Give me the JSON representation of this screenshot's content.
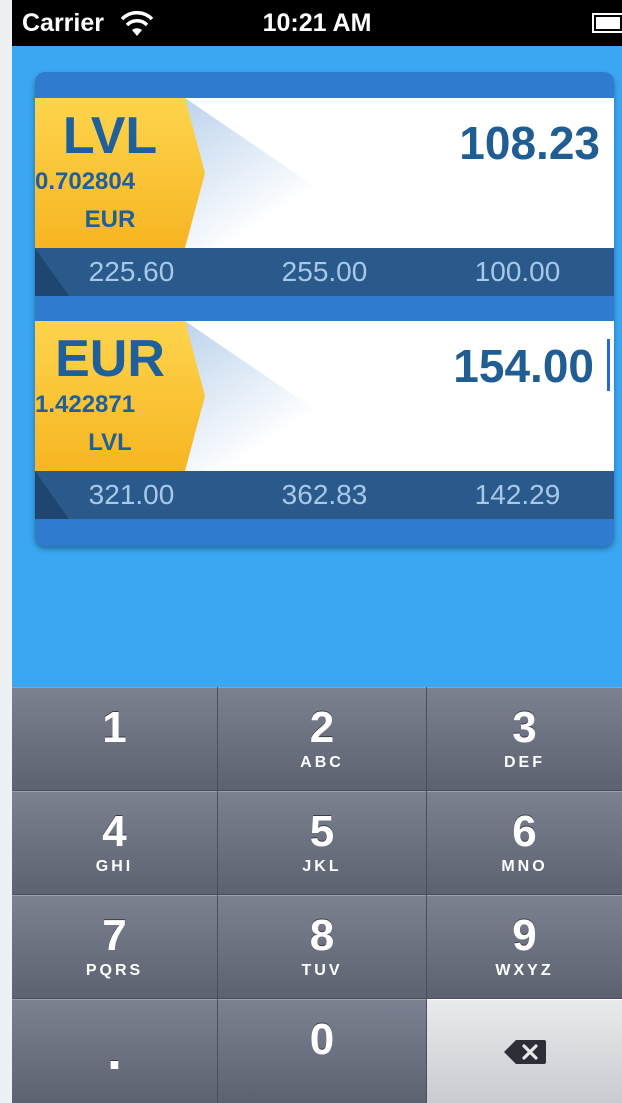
{
  "status_bar": {
    "carrier": "Carrier",
    "time": "10:21 AM",
    "wifi_icon": "wifi-icon",
    "battery_icon": "battery-icon"
  },
  "converters": [
    {
      "currency": "LVL",
      "rate": "0.702804",
      "target_currency": "EUR",
      "amount": "108.23",
      "quick_values": [
        "225.60",
        "255.00",
        "100.00"
      ]
    },
    {
      "currency": "EUR",
      "rate": "1.422871",
      "target_currency": "LVL",
      "amount": "154.00",
      "quick_values": [
        "321.00",
        "362.83",
        "142.29"
      ]
    }
  ],
  "keypad": {
    "keys": [
      {
        "digit": "1",
        "letters": ""
      },
      {
        "digit": "2",
        "letters": "ABC"
      },
      {
        "digit": "3",
        "letters": "DEF"
      },
      {
        "digit": "4",
        "letters": "GHI"
      },
      {
        "digit": "5",
        "letters": "JKL"
      },
      {
        "digit": "6",
        "letters": "MNO"
      },
      {
        "digit": "7",
        "letters": "PQRS"
      },
      {
        "digit": "8",
        "letters": "TUV"
      },
      {
        "digit": "9",
        "letters": "WXYZ"
      }
    ],
    "decimal": ".",
    "zero": "0",
    "delete_icon": "backspace-icon"
  },
  "colors": {
    "background": "#3aa7f3",
    "badge": "#f7b521",
    "currency_text": "#1e5f9c",
    "quickbar": "#2a5a8c",
    "caret": "#2668d8"
  }
}
